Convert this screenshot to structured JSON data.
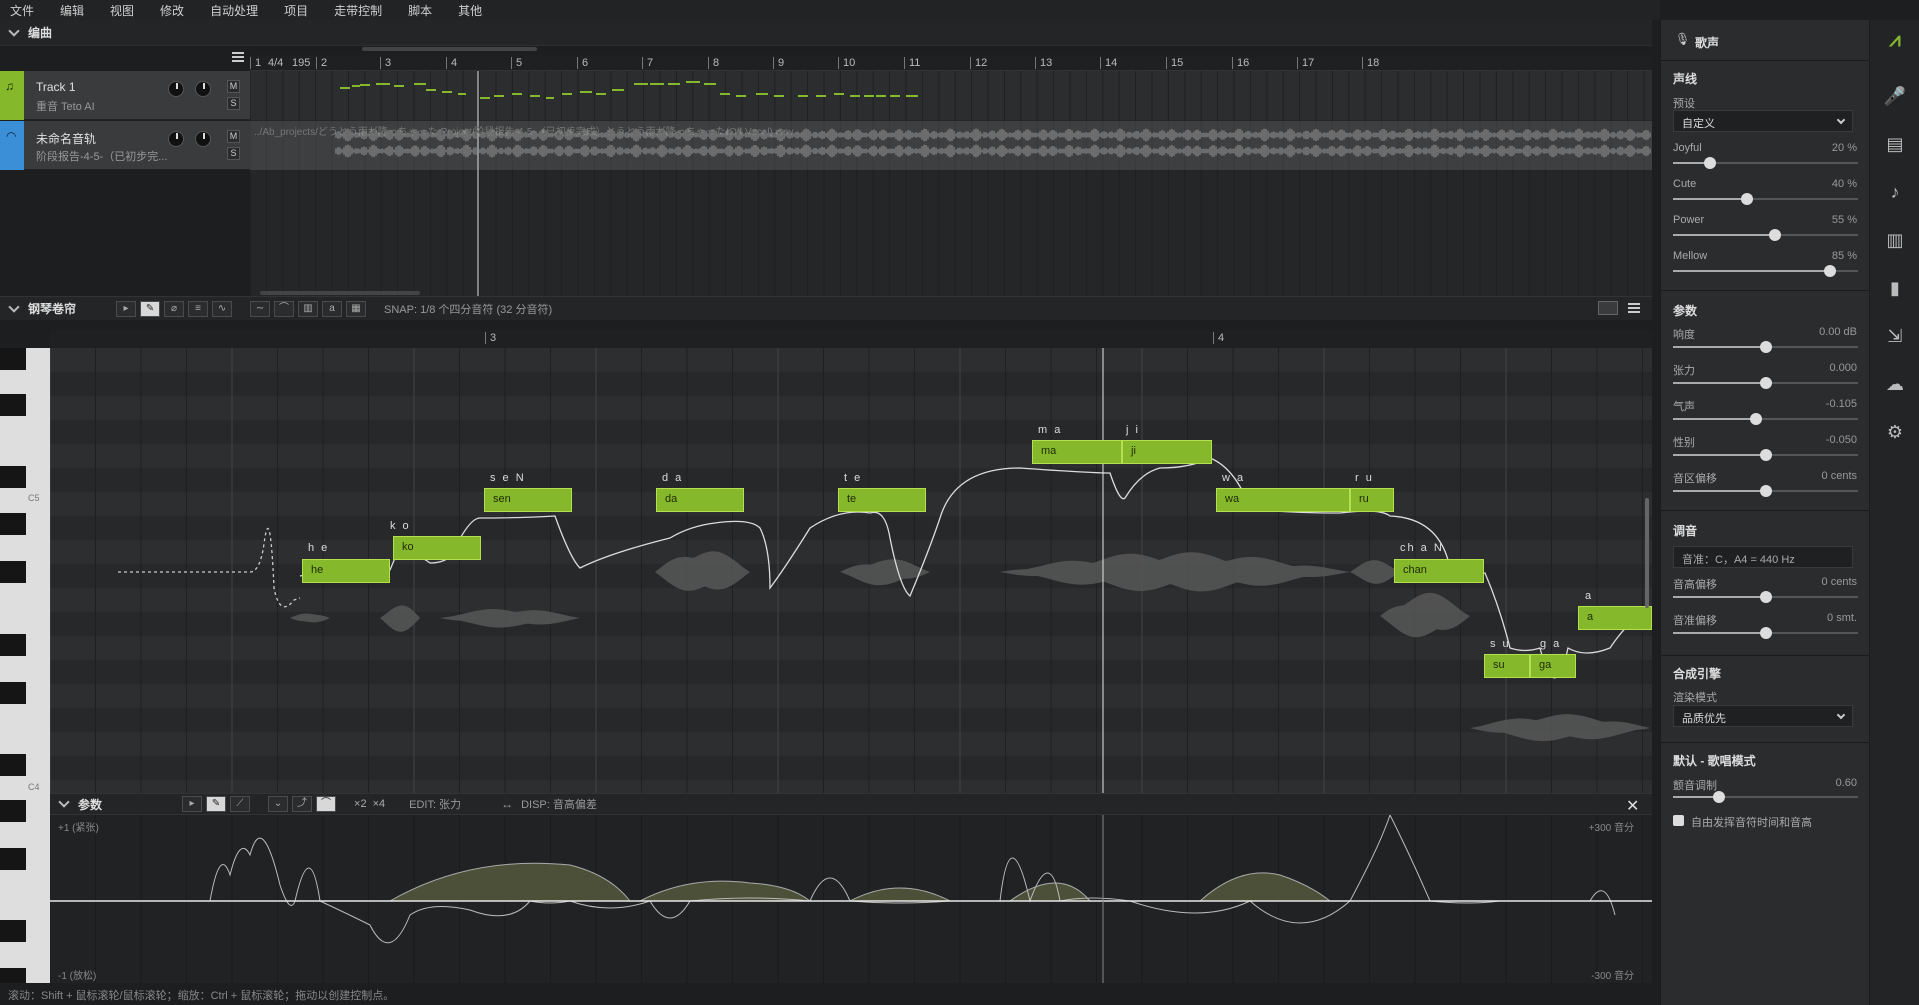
{
  "menu": [
    "文件",
    "编辑",
    "视图",
    "修改",
    "自动处理",
    "项目",
    "走带控制",
    "脚本",
    "其他"
  ],
  "arrangement": {
    "title": "编曲",
    "ruler": [
      {
        "label": "1"
      },
      {
        "label": "4/4"
      },
      {
        "label": "195"
      },
      {
        "label": "2"
      },
      {
        "label": "3"
      },
      {
        "label": "4"
      },
      {
        "label": "5"
      },
      {
        "label": "6"
      },
      {
        "label": "7"
      },
      {
        "label": "8"
      },
      {
        "label": "9"
      },
      {
        "label": "10"
      },
      {
        "label": "11"
      },
      {
        "label": "12"
      },
      {
        "label": "13"
      },
      {
        "label": "14"
      },
      {
        "label": "15"
      },
      {
        "label": "16"
      },
      {
        "label": "17"
      },
      {
        "label": "18"
      }
    ],
    "tracks": [
      {
        "name": "Track 1",
        "sub": "重音 Teto AI",
        "color": "#86b82c"
      },
      {
        "name": "未命名音轨",
        "sub": "阶段报告-4-5-（已初步完...",
        "color": "#3a8fd6"
      }
    ],
    "audio_path": "../Ab_projects/どうとう雨が降っちゃった Project/阶段报告-4-5-（已初步完成）とうとう雨が降っちゃった(Off Vocal).wav"
  },
  "piano_roll": {
    "title": "钢琴卷帘",
    "snap": "SNAP:   1/8 个四分音符 (32 分音符)",
    "bar3": "3",
    "bar4": "4",
    "key_c5": "C5",
    "key_c4": "C4",
    "notes": [
      {
        "lyric": "he",
        "phoneme": "h e"
      },
      {
        "lyric": "ko",
        "phoneme": "k o"
      },
      {
        "lyric": "sen",
        "phoneme": "s e N"
      },
      {
        "lyric": "da",
        "phoneme": "d a"
      },
      {
        "lyric": "te",
        "phoneme": "t e"
      },
      {
        "lyric": "ma",
        "phoneme": "m a"
      },
      {
        "lyric": "ji",
        "phoneme": "j i"
      },
      {
        "lyric": "wa",
        "phoneme": "w a"
      },
      {
        "lyric": "ru",
        "phoneme": "r u"
      },
      {
        "lyric": "chan",
        "phoneme": "ch a N"
      },
      {
        "lyric": "su",
        "phoneme": "s u"
      },
      {
        "lyric": "ga",
        "phoneme": "g a"
      },
      {
        "lyric": "a",
        "phoneme": "a"
      }
    ]
  },
  "params": {
    "title": "参数",
    "mult1": "×2",
    "mult2": "×4",
    "edit": "EDIT:   张力",
    "disp": "DISP:   音高偏差",
    "top_left": "+1 (紧张)",
    "bottom_left": "-1 (放松)",
    "top_right": "+300 音分",
    "bottom_right": "-300 音分"
  },
  "status": "滚动：Shift + 鼠标滚轮/鼠标滚轮；缩放：Ctrl + 鼠标滚轮；拖动以创建控制点。",
  "right_panel": {
    "header": "歌声",
    "voice_section": "声线",
    "preset_label": "预设",
    "preset_value": "自定义",
    "styles": [
      {
        "label": "Joyful",
        "value": "20 %",
        "level": 0.2
      },
      {
        "label": "Cute",
        "value": "40 %",
        "level": 0.4
      },
      {
        "label": "Power",
        "value": "55 %",
        "level": 0.55
      },
      {
        "label": "Mellow",
        "value": "85 %",
        "level": 0.85
      }
    ],
    "params_section": "参数",
    "params": [
      {
        "label": "响度",
        "value": "0.00 dB",
        "level": 0.5
      },
      {
        "label": "张力",
        "value": "0.000",
        "level": 0.5
      },
      {
        "label": "气声",
        "value": "-0.105",
        "level": 0.45
      },
      {
        "label": "性别",
        "value": "-0.050",
        "level": 0.5
      },
      {
        "label": "音区偏移",
        "value": "0 cents",
        "level": 0.5
      }
    ],
    "tuning_section": "调音",
    "tuning_field": "音准：C，A4 = 440 Hz",
    "tuning": [
      {
        "label": "音高偏移",
        "value": "0 cents",
        "level": 0.5
      },
      {
        "label": "音准偏移",
        "value": "0 smt.",
        "level": 0.5
      }
    ],
    "engine_section": "合成引擎",
    "render_label": "渲染模式",
    "render_value": "品质优先",
    "default_section": "默认 - 歌唱模式",
    "vibrato_label": "颤音调制",
    "vibrato_value": "0.60",
    "vibrato_level": 0.25,
    "checkbox_label": "自由发挥音符时间和音高"
  },
  "colors": {
    "accent": "#86b82c",
    "accent_border": "#b4e04e",
    "track_blue": "#3a8fd6"
  }
}
